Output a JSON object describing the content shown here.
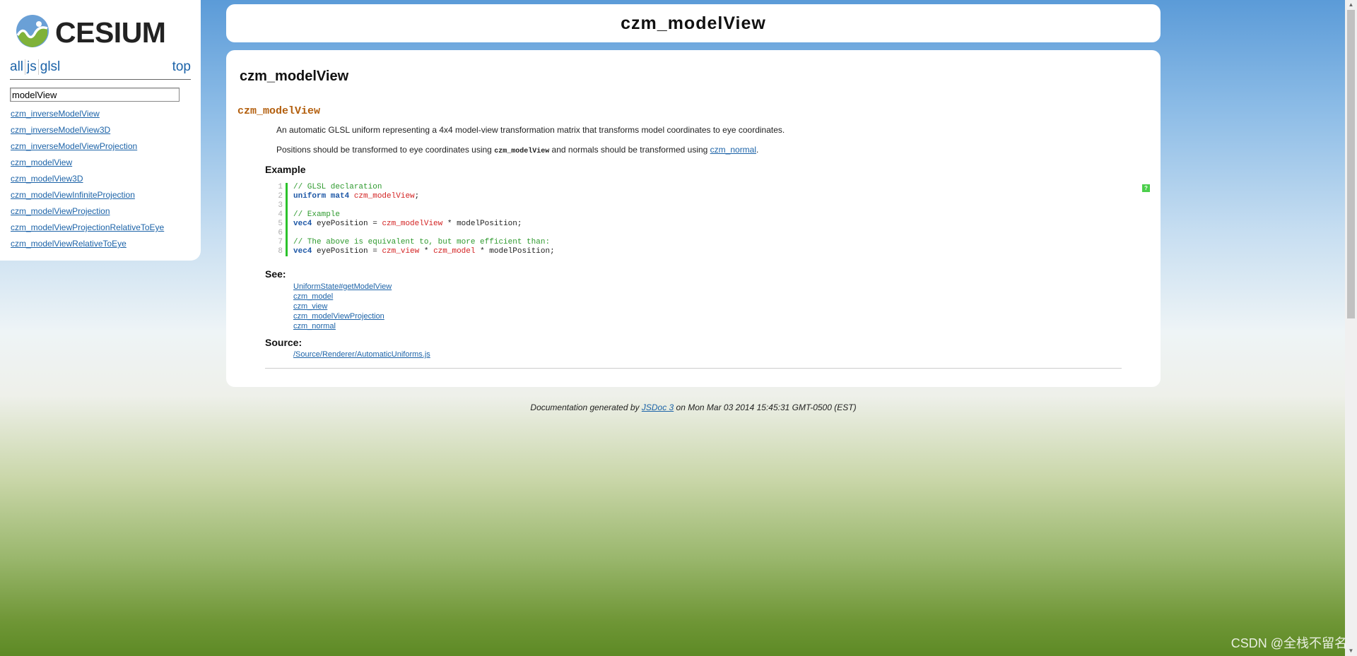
{
  "sidebar": {
    "logo_text": "CESIUM",
    "filters": {
      "all": "all",
      "js": "js",
      "glsl": "glsl",
      "top": "top"
    },
    "search": {
      "value": "modelView"
    },
    "links": [
      "czm_inverseModelView",
      "czm_inverseModelView3D",
      "czm_inverseModelViewProjection",
      "czm_modelView",
      "czm_modelView3D",
      "czm_modelViewInfiniteProjection",
      "czm_modelViewProjection",
      "czm_modelViewProjectionRelativeToEye",
      "czm_modelViewRelativeToEye"
    ]
  },
  "header": {
    "title": "czm_modelView"
  },
  "main": {
    "heading": "czm_modelView",
    "member_name": "czm_modelView",
    "description": "An automatic GLSL uniform representing a 4x4 model-view transformation matrix that transforms model coordinates to eye coordinates.",
    "positions_text_1": "Positions should be transformed to eye coordinates using ",
    "positions_code": "czm_modelView",
    "positions_text_2": " and normals should be transformed using ",
    "positions_link": "czm_normal",
    "positions_text_3": ".",
    "example_title": "Example",
    "code_lines": [
      "1",
      "2",
      "3",
      "4",
      "5",
      "6",
      "7",
      "8"
    ],
    "code": {
      "l1": "// GLSL declaration",
      "l2_kw": "uniform mat4",
      "l2_var": "czm_modelView",
      "l2_end": ";",
      "l4": "// Example",
      "l5_kw": "vec4",
      "l5_a": " eyePosition = ",
      "l5_var": "czm_modelView",
      "l5_b": " * modelPosition;",
      "l7": "// The above is equivalent to, but more efficient than:",
      "l8_kw": "vec4",
      "l8_a": " eyePosition = ",
      "l8_v1": "czm_view",
      "l8_b": " * ",
      "l8_v2": "czm_model",
      "l8_c": " * modelPosition;"
    },
    "help_icon": "?",
    "see_title": "See:",
    "see_links": [
      "UniformState#getModelView",
      "czm_model",
      "czm_view",
      "czm_modelViewProjection",
      "czm_normal"
    ],
    "source_title": "Source:",
    "source_link": "/Source/Renderer/AutomaticUniforms.js"
  },
  "footer": {
    "text_1": "Documentation generated by ",
    "link": "JSDoc 3",
    "text_2": " on Mon Mar 03 2014 15:45:31 GMT-0500 (EST)"
  },
  "watermark": "CSDN @全栈不留名",
  "colors": {
    "link": "#1c63a8",
    "member_name": "#b35f0e",
    "code_comment": "#2e9a2e",
    "code_keyword": "#1d57a6",
    "code_uniform": "#d32222",
    "code_bar": "#2bc22b"
  }
}
